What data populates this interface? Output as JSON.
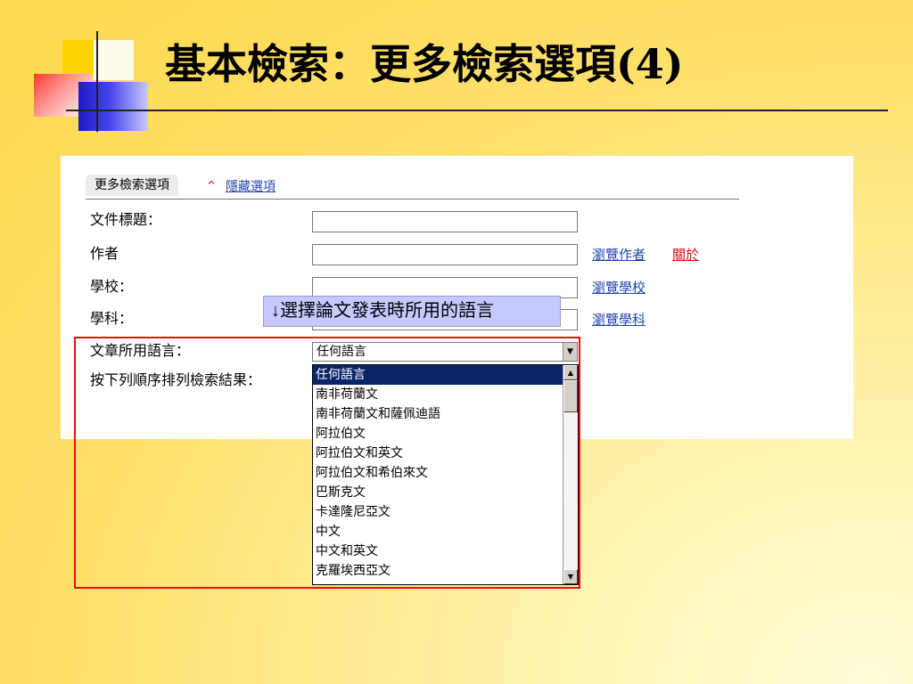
{
  "slide": {
    "title": "基本檢索：更多檢索選項(4)"
  },
  "tab": {
    "label": "更多檢索選項",
    "caret": "^",
    "hide_link": "隱藏選項"
  },
  "fields": [
    {
      "label": "文件標題："
    },
    {
      "label": "作者",
      "links": [
        "瀏覽作者",
        "關於"
      ]
    },
    {
      "label": "學校：",
      "links": [
        "瀏覽學校"
      ]
    },
    {
      "label": "學科：",
      "links": [
        "瀏覽學科"
      ]
    }
  ],
  "language": {
    "label": "文章所用語言：",
    "selected": "任何語言"
  },
  "sort": {
    "label": "按下列順序排列檢索結果："
  },
  "dropdown": {
    "options": [
      "任何語言",
      "南非荷蘭文",
      "南非荷蘭文和薩佩迪語",
      "阿拉伯文",
      "阿拉伯文和英文",
      "阿拉伯文和希伯來文",
      "巴斯克文",
      "卡達隆尼亞文",
      "中文",
      "中文和英文",
      "克羅埃西亞文"
    ],
    "selected_index": 0
  },
  "tooltip": {
    "text": "↓選擇論文發表時所用的語言"
  }
}
